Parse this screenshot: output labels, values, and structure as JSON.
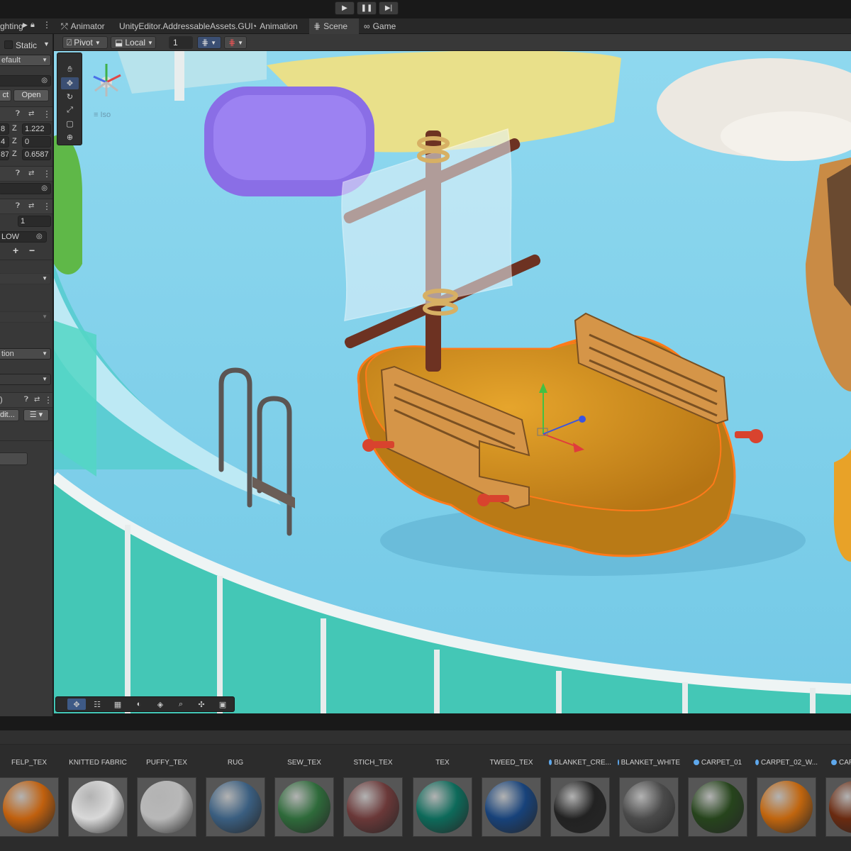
{
  "toolbar": {
    "play_icon": "play-icon",
    "pause_icon": "pause-icon",
    "step_icon": "step-icon"
  },
  "tabs": [
    {
      "label": "ghting",
      "icon": "lighting-icon"
    },
    {
      "label": "Animator",
      "icon": "animator-icon"
    },
    {
      "label": "UnityEditor.AddressableAssets.GUI",
      "icon": ""
    },
    {
      "label": "Animation",
      "icon": "animation-icon"
    },
    {
      "label": "Scene",
      "icon": "scene-grid-icon",
      "active": true
    },
    {
      "label": "Game",
      "icon": "gamepad-icon"
    }
  ],
  "inspector": {
    "static_label": "Static",
    "layer_value": "efault",
    "open_left": "ct",
    "open_button": "Open",
    "transform": {
      "row1_val": "8",
      "row1_axis": "Z",
      "row1_z": "1.222",
      "row2_val": "4",
      "row2_axis": "Z",
      "row2_z": "0",
      "row3_val": "87",
      "row3_axis": "Z",
      "row3_z": "0.6587"
    },
    "count_value": "1",
    "ow_value": "LOW",
    "plus": "+",
    "minus": "−",
    "tion_value": "tion",
    "edit_value": "dit...",
    "paren": ")"
  },
  "scene_toolbar": {
    "pivot_label": "Pivot",
    "local_label": "Local",
    "snap_value": "1",
    "iso_label": "Iso"
  },
  "colors": {
    "water": "#7fd0ea",
    "tile": "#4fd6c5",
    "sponge": "#d99a22",
    "selection": "#ff7a1a",
    "sel_tool": "#3b4f73",
    "accent_blue": "#5ea8ec"
  },
  "assets": [
    {
      "label": "FELP_TEX",
      "color": "#c0600e",
      "dot": false
    },
    {
      "label": "KNITTED FABRIC",
      "color": "#d8d8d8",
      "dot": false
    },
    {
      "label": "PUFFY_TEX",
      "color": "#b8b8b8",
      "dot": false
    },
    {
      "label": "RUG",
      "color": "#3a5e80",
      "dot": false
    },
    {
      "label": "SEW_TEX",
      "color": "#2e6a3a",
      "dot": false
    },
    {
      "label": "STICH_TEX",
      "color": "#6a3838",
      "dot": false
    },
    {
      "label": "TEX",
      "color": "#0d6a5a",
      "dot": false
    },
    {
      "label": "TWEED_TEX",
      "color": "#17427a",
      "dot": false
    },
    {
      "label": "BLANKET_CRE...",
      "color": "#222222",
      "dot": true
    },
    {
      "label": "BLANKET_WHITE",
      "color": "#4a4a4a",
      "dot": true
    },
    {
      "label": "CARPET_01",
      "color": "#26441c",
      "dot": true
    },
    {
      "label": "CARPET_02_W...",
      "color": "#c0650e",
      "dot": true
    },
    {
      "label": "CAR",
      "color": "#6a2a10",
      "dot": true
    }
  ]
}
